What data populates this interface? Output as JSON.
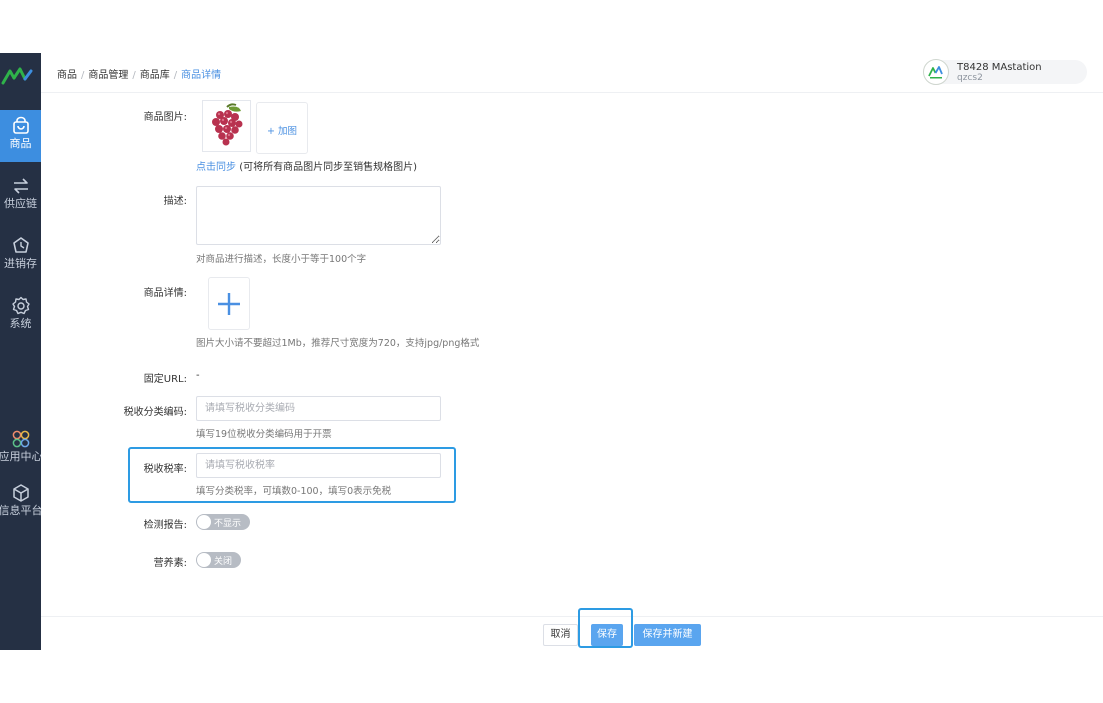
{
  "sidebar": {
    "items": [
      {
        "label": "商品",
        "icon": "bag-icon"
      },
      {
        "label": "供应链",
        "icon": "exchange-icon"
      },
      {
        "label": "进销存",
        "icon": "recycle-icon"
      },
      {
        "label": "系统",
        "icon": "gear-icon"
      },
      {
        "label": "应用中心",
        "icon": "apps-icon"
      },
      {
        "label": "信息平台",
        "icon": "cube-icon"
      }
    ]
  },
  "breadcrumb": {
    "items": [
      "商品",
      "商品管理",
      "商品库"
    ],
    "current": "商品详情",
    "separator": "/"
  },
  "user": {
    "name": "T8428 MAstation",
    "account": "qzcs2"
  },
  "form": {
    "images_label": "商品图片:",
    "add_image_label": "+ 加图",
    "sync_link": "点击同步",
    "sync_note": "(可将所有商品图片同步至销售规格图片)",
    "desc_label": "描述:",
    "desc_value": "",
    "desc_hint": "对商品进行描述，长度小于等于100个字",
    "detail_label": "商品详情:",
    "detail_hint": "图片大小请不要超过1Mb，推荐尺寸宽度为720，支持jpg/png格式",
    "url_label": "固定URL:",
    "url_value": "-",
    "tax_code_label": "税收分类编码:",
    "tax_code_value": "",
    "tax_code_placeholder": "请填写税收分类编码",
    "tax_code_hint": "填写19位税收分类编码用于开票",
    "tax_rate_label": "税收税率:",
    "tax_rate_value": "",
    "tax_rate_placeholder": "请填写税收税率",
    "tax_rate_hint": "填写分类税率，可填数0-100，填写0表示免税",
    "report_label": "检测报告:",
    "report_toggle": "不显示",
    "nutrition_label": "营养素:",
    "nutrition_toggle": "关闭"
  },
  "footer": {
    "cancel": "取消",
    "save": "保存",
    "save_new": "保存并新建"
  },
  "colors": {
    "sidebar_bg": "#253044",
    "accent": "#4a90e2",
    "primary_button": "#5aa5ef",
    "highlight_border": "#2d9be3",
    "toggle_off": "#b7bcc4"
  }
}
